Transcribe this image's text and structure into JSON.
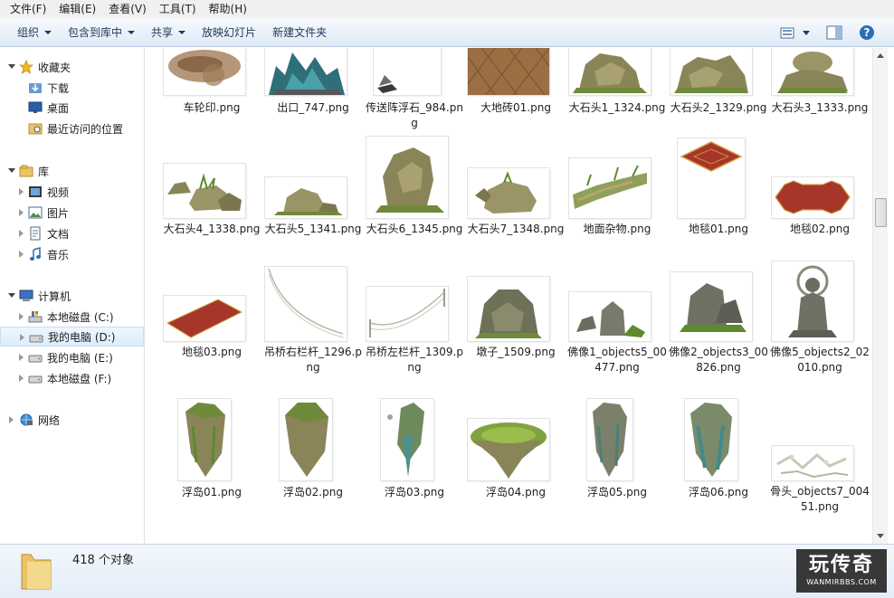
{
  "menu": [
    "文件(F)",
    "编辑(E)",
    "查看(V)",
    "工具(T)",
    "帮助(H)"
  ],
  "toolbar": {
    "organize": "组织",
    "include_in_library": "包含到库中",
    "share": "共享",
    "slideshow": "放映幻灯片",
    "new_folder": "新建文件夹"
  },
  "nav": {
    "favorites": "收藏夹",
    "downloads": "下载",
    "desktop": "桌面",
    "recent": "最近访问的位置",
    "libraries": "库",
    "videos": "视频",
    "pictures": "图片",
    "documents": "文档",
    "music": "音乐",
    "computer": "计算机",
    "drive_c": "本地磁盘 (C:)",
    "drive_d": "我的电脑 (D:)",
    "drive_e": "我的电脑 (E:)",
    "drive_f": "本地磁盘 (F:)",
    "network": "网络"
  },
  "files": [
    {
      "name": "车轮印.png",
      "thumb": "tracks"
    },
    {
      "name": "出口_747.png",
      "thumb": "exit-crystal"
    },
    {
      "name": "传送阵浮石_984.png",
      "thumb": "floating-stone"
    },
    {
      "name": "大地砖01.png",
      "thumb": "floor-tile"
    },
    {
      "name": "大石头1_1324.png",
      "thumb": "rock"
    },
    {
      "name": "大石头2_1329.png",
      "thumb": "rock"
    },
    {
      "name": "大石头3_1333.png",
      "thumb": "rock"
    },
    {
      "name": "大石头4_1338.png",
      "thumb": "rock"
    },
    {
      "name": "大石头5_1341.png",
      "thumb": "rock"
    },
    {
      "name": "大石头6_1345.png",
      "thumb": "rock"
    },
    {
      "name": "大石头7_1348.png",
      "thumb": "rock"
    },
    {
      "name": "地面杂物.png",
      "thumb": "ground-debris"
    },
    {
      "name": "地毯01.png",
      "thumb": "carpet"
    },
    {
      "name": "地毯02.png",
      "thumb": "carpet"
    },
    {
      "name": "地毯03.png",
      "thumb": "carpet"
    },
    {
      "name": "吊桥右栏杆_1296.png",
      "thumb": "rope"
    },
    {
      "name": "吊桥左栏杆_1309.png",
      "thumb": "rope"
    },
    {
      "name": "墩子_1509.png",
      "thumb": "pier"
    },
    {
      "name": "佛像1_objects5_00477.png",
      "thumb": "statue"
    },
    {
      "name": "佛像2_objects3_00826.png",
      "thumb": "statue"
    },
    {
      "name": "佛像5_objects2_02010.png",
      "thumb": "statue"
    },
    {
      "name": "浮岛01.png",
      "thumb": "floating-island"
    },
    {
      "name": "浮岛02.png",
      "thumb": "floating-island"
    },
    {
      "name": "浮岛03.png",
      "thumb": "floating-island"
    },
    {
      "name": "浮岛04.png",
      "thumb": "grass-island"
    },
    {
      "name": "浮岛05.png",
      "thumb": "floating-island"
    },
    {
      "name": "浮岛06.png",
      "thumb": "floating-island"
    },
    {
      "name": "骨头_objects7_00451.png",
      "thumb": "bones"
    }
  ],
  "status": {
    "count": "418 个对象"
  },
  "watermark": {
    "title": "玩传奇",
    "subtitle": "WANMIRBBS.COM"
  },
  "colors": {
    "toolbar_text": "#1e395b",
    "selection": "#dcedfc",
    "rock": "#8a8459",
    "carpet": "#a6362a",
    "moss": "#6f8a3a"
  }
}
